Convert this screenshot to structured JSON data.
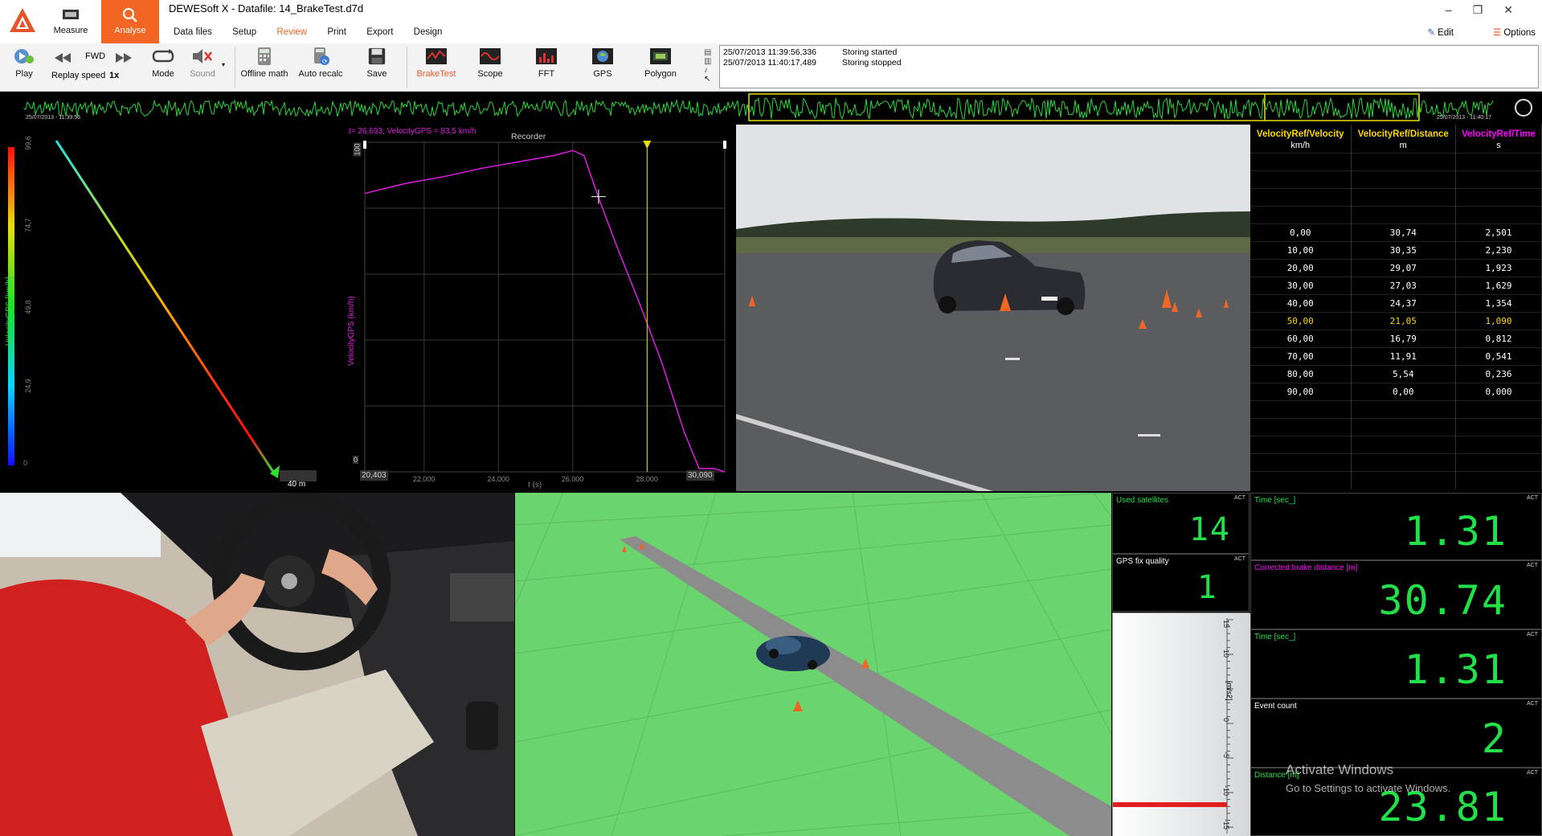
{
  "title": "DEWESoft X - Datafile: 14_BrakeTest.d7d",
  "modes": [
    {
      "label": "Measure",
      "active": false
    },
    {
      "label": "Analyse",
      "active": true
    }
  ],
  "menus": [
    "Data files",
    "Setup",
    "Review",
    "Print",
    "Export",
    "Design"
  ],
  "active_menu": "Review",
  "right_menu": {
    "edit": "Edit",
    "options": "Options"
  },
  "toolbar": {
    "play": "Play",
    "fwd": "FWD",
    "replay_speed": "Replay speed",
    "replay_value": "1x",
    "mode": "Mode",
    "sound": "Sound",
    "offline_math": "Offline math",
    "auto_recalc": "Auto recalc",
    "save": "Save",
    "screens": [
      "BrakeTest",
      "Scope",
      "FFT",
      "GPS",
      "Polygon"
    ],
    "active_screen": "BrakeTest"
  },
  "event_log": [
    {
      "time": "25/07/2013 11:39:56,336",
      "text": "Storing started"
    },
    {
      "time": "25/07/2013 11:40:17,489",
      "text": "Storing stopped"
    }
  ],
  "overview": {
    "start": "25/07/2013 - 11:39:56",
    "end": "25/07/2013 - 11:40:17"
  },
  "polar": {
    "axis_label": "VelocityGPS [km/h]",
    "ticks": [
      "99,6",
      "74,7",
      "49,8",
      "24,9",
      "0"
    ],
    "scale_label": "40 m"
  },
  "recorder": {
    "title": "Recorder",
    "cursor_readout": "t= 26,693; VelocityGPS = 83,5 km/h",
    "ylabel": "VelocityGPS (km/h)",
    "xlabel": "t (s)",
    "y_top": "100",
    "y_bottom": "0",
    "x_start": "20,403",
    "x_end": "30,090",
    "x_ticks": [
      "22,000",
      "24,000",
      "26,000",
      "28,000"
    ],
    "colors": {
      "trace": "#e01ee0",
      "marker": "#e8e000"
    }
  },
  "chart_data": {
    "type": "line",
    "title": "Recorder",
    "xlabel": "t (s)",
    "ylabel": "VelocityGPS (km/h)",
    "xlim": [
      20.403,
      30.09
    ],
    "ylim": [
      0,
      100
    ],
    "series": [
      {
        "name": "VelocityGPS",
        "x": [
          20.403,
          21.5,
          22.5,
          23.5,
          24.5,
          25.5,
          26.0,
          26.3,
          26.7,
          27.2,
          27.8,
          28.4,
          29.0,
          29.4,
          29.8,
          30.09
        ],
        "y": [
          84.5,
          87.5,
          89.5,
          92,
          94,
          96,
          97.5,
          96,
          83,
          68,
          51,
          33,
          12,
          1,
          1,
          0
        ]
      }
    ],
    "marker_x": 28.0
  },
  "table": {
    "headers": [
      {
        "title": "VelocityRef/Velocity",
        "unit": "km/h"
      },
      {
        "title": "VelocityRef/Distance",
        "unit": "m"
      },
      {
        "title": "VelocityRef/Time",
        "unit": "s"
      }
    ],
    "rows": [
      [
        "0,00",
        "30,74",
        "2,501"
      ],
      [
        "10,00",
        "30,35",
        "2,230"
      ],
      [
        "20,00",
        "29,07",
        "1,923"
      ],
      [
        "30,00",
        "27,03",
        "1,629"
      ],
      [
        "40,00",
        "24,37",
        "1,354"
      ],
      [
        "50,00",
        "21,05",
        "1,090"
      ],
      [
        "60,00",
        "16,79",
        "0,812"
      ],
      [
        "70,00",
        "11,91",
        "0,541"
      ],
      [
        "80,00",
        "5,54",
        "0,236"
      ],
      [
        "90,00",
        "0,00",
        "0,000"
      ]
    ],
    "highlight_row": 5
  },
  "meters": [
    {
      "caption": "Used satellites",
      "value": "14",
      "captionColor": "#22e04a"
    },
    {
      "caption": "GPS fix quality",
      "value": "1",
      "captionColor": "#ffffff"
    },
    {
      "caption": "Time [sec_]",
      "value": "1.31",
      "captionColor": "#22e04a"
    },
    {
      "caption": "Corrected brake distance [m]",
      "value": "30.74",
      "captionColor": "#ff00ff"
    },
    {
      "caption": "Time [sec_]",
      "value": "1.31",
      "captionColor": "#22e04a"
    },
    {
      "caption": "Event count",
      "value": "2",
      "captionColor": "#ffffff"
    },
    {
      "caption": "Distance [m]",
      "value": "23.81",
      "captionColor": "#22e04a"
    }
  ],
  "act_label": "ACT",
  "accel_meter": {
    "unit": "[m/s2]",
    "ticks": [
      "15",
      "10",
      "5",
      "0",
      "-5",
      "-10",
      "-15"
    ],
    "value": -13.5
  },
  "watermark": {
    "line1": "Activate Windows",
    "line2": "Go to Settings to activate Windows."
  }
}
